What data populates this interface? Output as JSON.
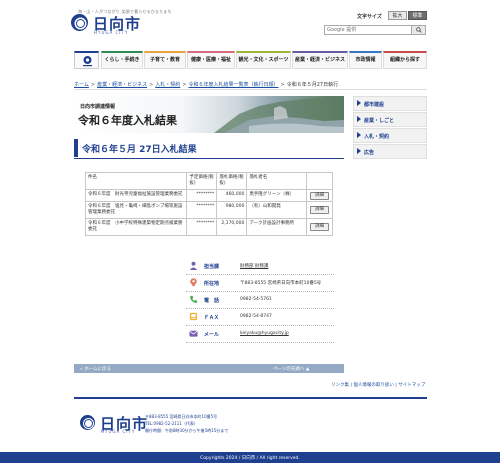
{
  "header": {
    "tagline": "海・山・人がつながり 笑顔で暮らせるひなたまち",
    "logo_text": "日向市",
    "logo_sub": "HYUGA CITY",
    "fontsize_label": "文字サイズ",
    "fontsize_large": "拡大",
    "fontsize_standard": "標準",
    "search_placeholder": "Google 提供"
  },
  "nav": {
    "items": [
      {
        "label": "くらし・手続き",
        "color": "#2e8b57"
      },
      {
        "label": "子育て・教育",
        "color": "#e8a33d"
      },
      {
        "label": "健康・医療・福祉",
        "color": "#d96a7f"
      },
      {
        "label": "観光・文化・スポーツ",
        "color": "#9bb636"
      },
      {
        "label": "産業・経済・ビジネス",
        "color": "#6b5aa6"
      },
      {
        "label": "市政情報",
        "color": "#3a78c4"
      },
      {
        "label": "組織から探す",
        "color": "#c84b4b"
      }
    ]
  },
  "breadcrumb": [
    "ホーム",
    "産業・経済・ビジネス",
    "入札・契約",
    "令和６年度入札結果一覧表（執行日順）",
    "令和６年５月27日執行"
  ],
  "hero": {
    "label": "日向市調達情報",
    "title": "令和６年度入札結果"
  },
  "sidenav": [
    "都市建設",
    "産業・しごと",
    "入札・契約",
    "広告"
  ],
  "page_title": "令和６年５月 27日入札結果",
  "table": {
    "headers": [
      "件名",
      "予定価格(税抜)",
      "落札価格(税抜)",
      "落札者名",
      ""
    ],
    "rows": [
      {
        "name": "令和６年度　財光寺児童福祉施設管理業務委託",
        "planned": "********",
        "winning": "460,000",
        "winner": "黒手隆グリーン（株）",
        "button": "詳細"
      },
      {
        "name": "令和６年度　塩見・亀崎・細島ポンプ場等施設管理業務委託",
        "planned": "********",
        "winning": "980,000",
        "winner": "（有）山和開発",
        "button": "詳細"
      },
      {
        "name": "令和６年度　小中学校特殊建築物定期点検業務委託",
        "planned": "********",
        "winning": "2,170,000",
        "winner": "アーク計画設計事務所",
        "button": "詳細"
      }
    ]
  },
  "contact": {
    "rows": [
      {
        "label": "担当課",
        "value": "財務部 財務課",
        "icon": "person-icon",
        "link": true
      },
      {
        "label": "所在地",
        "value": "〒883-8555 宮崎県日向市本町10番5号",
        "icon": "map-pin-icon",
        "link": false
      },
      {
        "label": "電　話",
        "value": "0982-54-5761",
        "icon": "phone-icon",
        "link": false
      },
      {
        "label": "ＦＡＸ",
        "value": "0982-54-8747",
        "icon": "fax-icon",
        "link": false
      },
      {
        "label": "メール",
        "value": "keiyaku@hyugacity.jp",
        "icon": "mail-icon",
        "link": true
      }
    ]
  },
  "pagebar": {
    "back": "ホームに戻る",
    "top": "ページの先頭へ"
  },
  "footer_links": "リンク集 | 個人情報の取り扱い | サイトマップ",
  "footer": {
    "logo_text": "日向市",
    "logo_sub": "HYUGA CITY",
    "address": "〒883-8555 宮崎県日向市本町10番5号",
    "tel": "TEL:0982-52-2111（代表）",
    "hours": "開庁時間：午前8時30分から午後5時15分まで",
    "copyright": "Copyrights 2024 / 日向市 / All right reserved."
  },
  "colors": {
    "brand": "#1f3f8f",
    "pagebar": "#93a9c4"
  }
}
